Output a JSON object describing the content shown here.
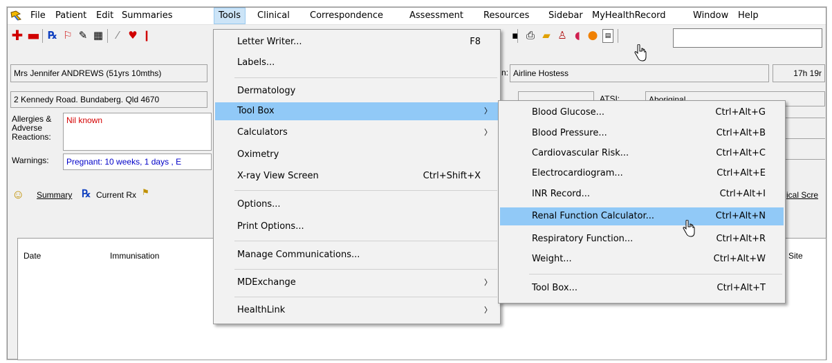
{
  "menubar": {
    "items": [
      "File",
      "Patient",
      "Edit",
      "Summaries",
      "Tools",
      "Clinical",
      "Correspondence",
      "Assessment",
      "Resources",
      "Sidebar",
      "MyHealthRecord",
      "Window",
      "Help"
    ],
    "active": "Tools"
  },
  "toolbar": {
    "search_value": ""
  },
  "patient": {
    "name": "Mrs Jennifer ANDREWS (51yrs 10mths)",
    "address": "2 Kennedy Road. Bundaberg. Qld  4670",
    "occupation_label": "n:",
    "occupation": "Airline Hostess",
    "time": "17h 19r",
    "atsi_label": "ATSI:",
    "atsi_value": "Aboriginal",
    "allergies_label": "Allergies & Adverse Reactions:",
    "allergies_value": "Nil known",
    "warnings_label": "Warnings:",
    "warnings_value": "Pregnant:  10 weeks, 1 days , E"
  },
  "tabs": {
    "summary": "Summary",
    "current_rx": "Current Rx",
    "right_cut": "ical Scre"
  },
  "list": {
    "col_date": "Date",
    "col_immunisation": "Immunisation",
    "col_site": "Site"
  },
  "tools_menu": {
    "items": [
      {
        "label": "Letter Writer...",
        "shortcut": "F8"
      },
      {
        "label": "Labels...",
        "shortcut": ""
      },
      {
        "label": "Dermatology",
        "shortcut": ""
      },
      {
        "label": "Tool Box",
        "shortcut": "",
        "submenu": true
      },
      {
        "label": "Calculators",
        "shortcut": "",
        "submenu": true
      },
      {
        "label": "Oximetry",
        "shortcut": ""
      },
      {
        "label": "X-ray View Screen",
        "shortcut": "Ctrl+Shift+X"
      },
      {
        "label": "Options...",
        "shortcut": ""
      },
      {
        "label": "Print Options...",
        "shortcut": ""
      },
      {
        "label": "Manage Communications...",
        "shortcut": ""
      },
      {
        "label": "MDExchange",
        "shortcut": "",
        "submenu": true
      },
      {
        "label": "HealthLink",
        "shortcut": "",
        "submenu": true
      }
    ]
  },
  "toolbox_menu": {
    "items": [
      {
        "label": "Blood Glucose...",
        "shortcut": "Ctrl+Alt+G"
      },
      {
        "label": "Blood Pressure...",
        "shortcut": "Ctrl+Alt+B"
      },
      {
        "label": "Cardiovascular Risk...",
        "shortcut": "Ctrl+Alt+C"
      },
      {
        "label": "Electrocardiogram...",
        "shortcut": "Ctrl+Alt+E"
      },
      {
        "label": "INR Record...",
        "shortcut": "Ctrl+Alt+I"
      },
      {
        "label": "Renal Function Calculator...",
        "shortcut": "Ctrl+Alt+N"
      },
      {
        "label": "Respiratory Function...",
        "shortcut": "Ctrl+Alt+R"
      },
      {
        "label": "Weight...",
        "shortcut": "Ctrl+Alt+W"
      },
      {
        "label": "Tool Box...",
        "shortcut": "Ctrl+Alt+T"
      }
    ]
  },
  "colors": {
    "menu_highlight": "#91c9f7",
    "menubar_active": "#cce4f7",
    "allergy_text": "#d40000",
    "warning_text": "#0000c8"
  }
}
